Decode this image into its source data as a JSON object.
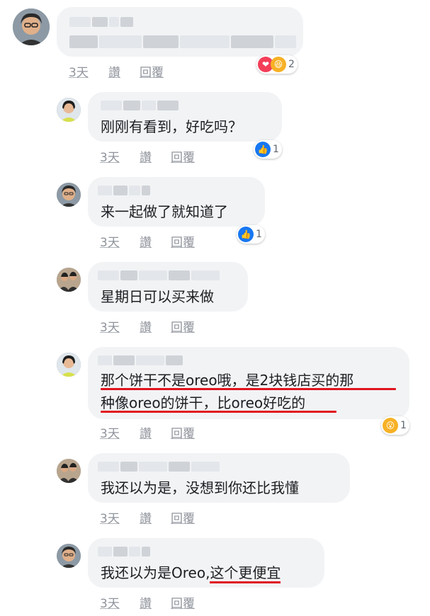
{
  "comments": [
    {
      "text": "",
      "actions": {
        "time": "3天",
        "like": "讚",
        "reply": "回覆"
      },
      "reactions": {
        "icons": [
          "love-icon",
          "haha-icon"
        ],
        "count": "2"
      }
    },
    {
      "text": "刚刚有看到，好吃吗？",
      "actions": {
        "time": "3天",
        "like": "讚",
        "reply": "回覆"
      },
      "reactions": {
        "icons": [
          "like-icon"
        ],
        "count": "1"
      }
    },
    {
      "text": "来一起做了就知道了",
      "actions": {
        "time": "3天",
        "like": "讚",
        "reply": "回覆"
      },
      "reactions": {
        "icons": [
          "like-icon"
        ],
        "count": "1"
      }
    },
    {
      "text": "星期日可以买来做",
      "actions": {
        "time": "3天",
        "like": "讚",
        "reply": "回覆"
      }
    },
    {
      "text_line1": "那个饼干不是oreo哦，是2块钱店买的那",
      "text_line2": "种像oreo的饼干，比oreo好吃的",
      "actions": {
        "time": "3天",
        "like": "讚",
        "reply": "回覆"
      },
      "reactions": {
        "icons": [
          "wow-icon"
        ],
        "count": "1"
      }
    },
    {
      "text": "我还以为是，没想到你还比我懂",
      "actions": {
        "time": "3天",
        "like": "讚",
        "reply": "回覆"
      }
    },
    {
      "text_a": "我还以为是Oreo,",
      "text_b": "这个更便宜",
      "actions": {
        "time": "3天",
        "like": "讚",
        "reply": "回覆"
      }
    }
  ],
  "colors": {
    "bubble": "#f2f3f5",
    "meta": "#90949c",
    "underline": "#e0141f",
    "like": "#1877f2",
    "love": "#f33e58",
    "haha": "#f7b125"
  }
}
